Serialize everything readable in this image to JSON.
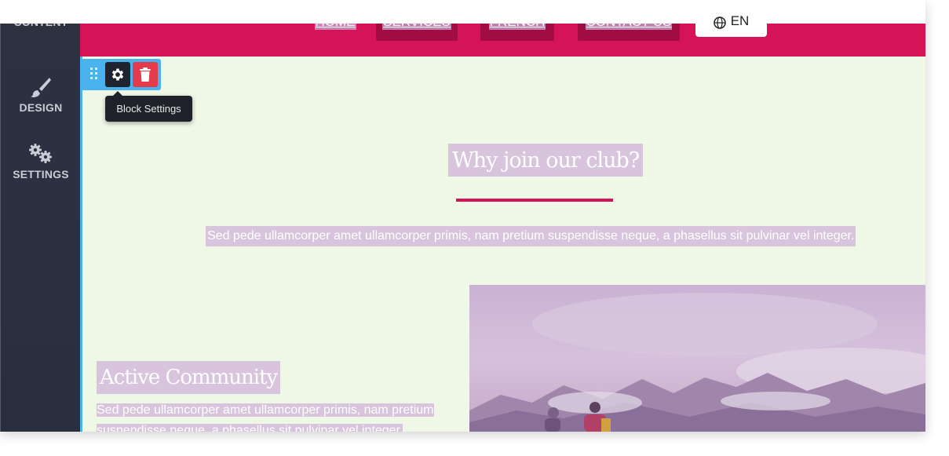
{
  "sidebar": {
    "items": [
      {
        "label": "CONTENT",
        "icon": "content-icon"
      },
      {
        "label": "DESIGN",
        "icon": "brush-icon"
      },
      {
        "label": "SETTINGS",
        "icon": "gears-icon"
      }
    ]
  },
  "nav": {
    "items": [
      "HOME",
      "SERVICES",
      "FRENCH",
      "CONTACT US"
    ],
    "language": "EN",
    "colors": {
      "bar": "#d41456",
      "active": "#a20d41"
    }
  },
  "block_toolbar": {
    "drag_icon": "drag-handle-icon",
    "settings_icon": "gear-icon",
    "delete_icon": "trash-icon",
    "tooltip": "Block Settings"
  },
  "section": {
    "heading": "Why join our club?",
    "intro": "Sed pede ullamcorper amet ullamcorper primis, nam pretium suspendisse neque, a phasellus sit pulvinar vel integer.",
    "feature_heading": "Active Community",
    "feature_text": "Sed pede ullamcorper amet ullamcorper primis, nam pretium suspendisse neque, a phasellus sit pulvinar vel integer."
  }
}
